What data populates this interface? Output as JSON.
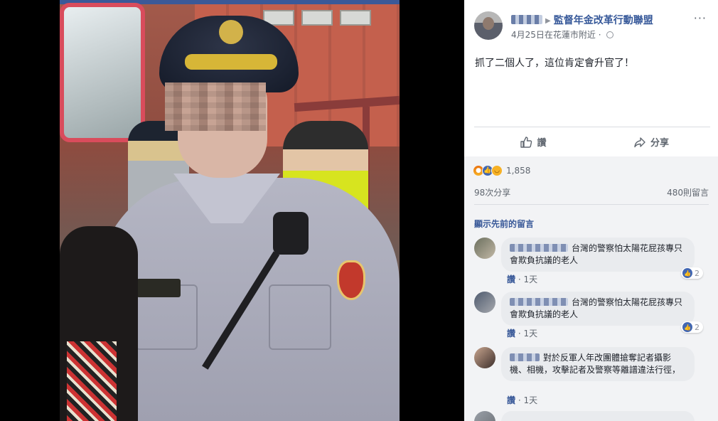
{
  "post": {
    "page_name": "監督年金改革行動聯盟",
    "date": "4月25日",
    "location": "在花蓮市附近",
    "more": "···",
    "text": "抓了二個人了，這位肯定會升官了！"
  },
  "actions": {
    "like_label": "讚",
    "share_label": "分享"
  },
  "stats": {
    "reaction_count": "1,858",
    "shares": "98次分享",
    "comments_count": "480則留言",
    "previous_comments": "顯示先前的留言"
  },
  "comments": [
    {
      "text": "台灣的警察怕太陽花屁孩專只會欺負抗議的老人",
      "like_link": "讚",
      "time": "1天",
      "likes": "2"
    },
    {
      "text": "台灣的警察怕太陽花屁孩專只會欺負抗議的老人",
      "like_link": "讚",
      "time": "1天",
      "likes": "2"
    },
    {
      "text": "對於反軍人年改團體搶奪記者攝影機、相機，攻擊記者及警察等離譜違法行徑，",
      "like_link": "讚",
      "time": "1天"
    }
  ],
  "colors": {
    "link": "#365899",
    "like_blue": "#4267b2",
    "panel_bg": "#ffffff",
    "stats_bg": "#f2f3f5"
  },
  "icons": [
    "thumbs-up-icon",
    "share-arrow-icon",
    "globe-icon",
    "more-icon",
    "angry-reaction-icon",
    "like-reaction-icon",
    "haha-reaction-icon",
    "caret-right-icon"
  ]
}
